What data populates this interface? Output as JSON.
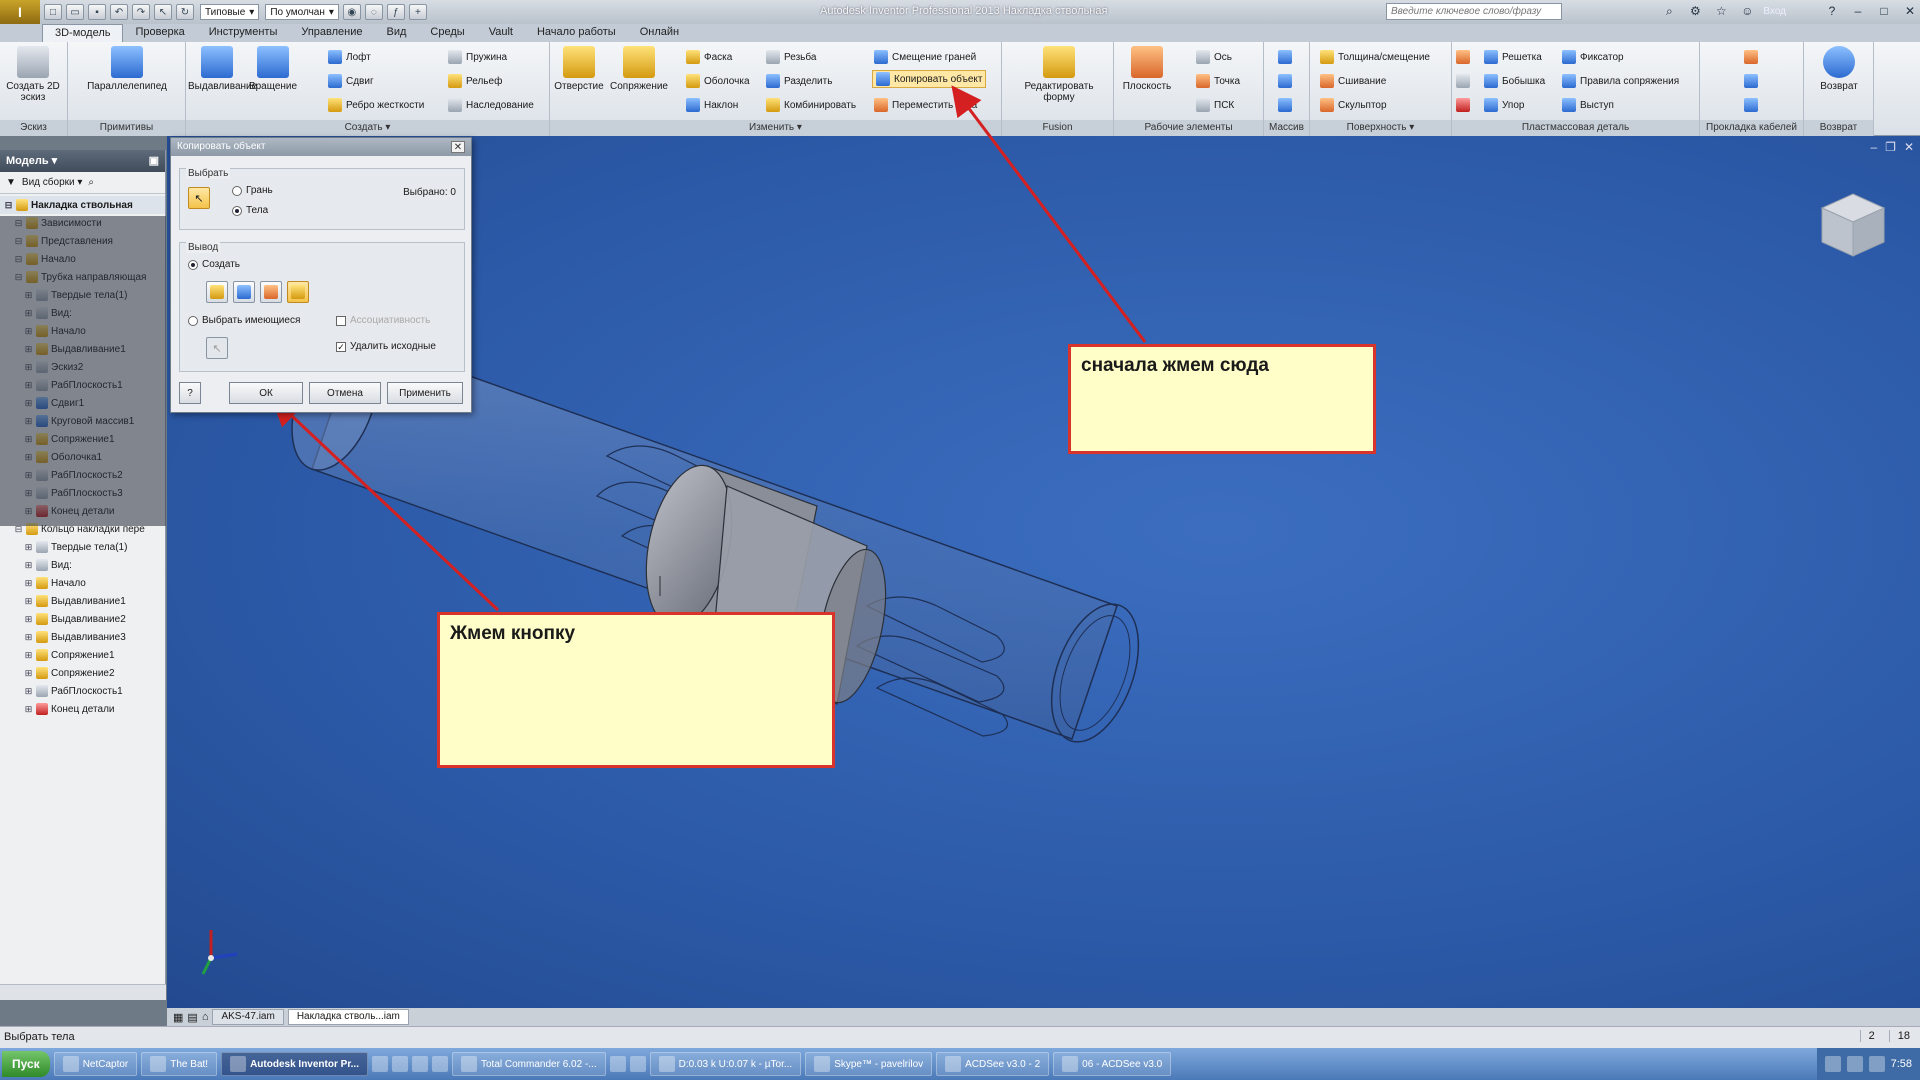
{
  "titlebar": {
    "app_title": "Autodesk Inventor Professional 2013   Накладка ствольная",
    "combo_style": "Типовые",
    "combo_material": "По умолчан",
    "search_placeholder": "Введите ключевое слово/фразу",
    "login": "Вход"
  },
  "ribbon_tabs": [
    "3D-модель",
    "Проверка",
    "Инструменты",
    "Управление",
    "Вид",
    "Среды",
    "Vault",
    "Начало работы",
    "Онлайн"
  ],
  "ribbon": {
    "panels": {
      "sketch": "Эскиз",
      "primitives": "Примитивы",
      "create": "Создать",
      "modify": "Изменить",
      "fusion": "Fusion",
      "work_features": "Рабочие элементы",
      "pattern": "Массив",
      "surface": "Поверхность",
      "plastic": "Пластмассовая деталь",
      "cable": "Прокладка кабелей",
      "return": "Возврат"
    },
    "tools": {
      "create_2d_sketch": "Создать 2D эскиз",
      "box": "Параллелепипед",
      "extrude": "Выдавливание",
      "revolve": "Вращение",
      "loft": "Лофт",
      "sweep": "Сдвиг",
      "rib": "Ребро жесткости",
      "coil": "Пружина",
      "emboss": "Рельеф",
      "derive": "Наследование",
      "hole": "Отверстие",
      "fillet": "Сопряжение",
      "chamfer": "Фаска",
      "shell": "Оболочка",
      "draft": "Наклон",
      "thread": "Резьба",
      "split": "Разделить",
      "combine": "Комбинировать",
      "face_offset": "Смещение граней",
      "copy_object": "Копировать объект",
      "move_bodies": "Переместить тела",
      "edit_form": "Редактировать форму",
      "plane": "Плоскость",
      "axis": "Ось",
      "point": "Точка",
      "ucs": "ПСК",
      "thicken": "Толщина/смещение",
      "stitch": "Сшивание",
      "sculpt": "Скульптор",
      "grill": "Решетка",
      "boss": "Бобышка",
      "rest": "Упор",
      "snap_fit": "Фиксатор",
      "rule_fillet": "Правила сопряжения",
      "lip": "Выступ",
      "return": "Возврат"
    }
  },
  "browser": {
    "title": "Модель",
    "view_mode": "Вид сборки",
    "tree": [
      {
        "label": "Накладка ствольная",
        "level": 0,
        "icon": "assembly-icon",
        "root": true
      },
      {
        "label": "Зависимости",
        "level": 1,
        "icon": "folder-icon"
      },
      {
        "label": "Представления",
        "level": 1,
        "icon": "folder-icon"
      },
      {
        "label": "Начало",
        "level": 1,
        "icon": "folder-icon"
      },
      {
        "label": "Трубка направляющая",
        "level": 1,
        "icon": "part-icon"
      },
      {
        "label": "Твердые тела(1)",
        "level": 2,
        "icon": "solid-icon"
      },
      {
        "label": "Вид:",
        "level": 2,
        "icon": "view-icon"
      },
      {
        "label": "Начало",
        "level": 2,
        "icon": "folder-icon"
      },
      {
        "label": "Выдавливание1",
        "level": 2,
        "icon": "extrude-icon"
      },
      {
        "label": "Эскиз2",
        "level": 2,
        "icon": "sketch-icon"
      },
      {
        "label": "РабПлоскость1",
        "level": 2,
        "icon": "plane-icon"
      },
      {
        "label": "Сдвиг1",
        "level": 2,
        "icon": "sweep-icon"
      },
      {
        "label": "Круговой массив1",
        "level": 2,
        "icon": "pattern-icon"
      },
      {
        "label": "Сопряжение1",
        "level": 2,
        "icon": "fillet-icon"
      },
      {
        "label": "Оболочка1",
        "level": 2,
        "icon": "shell-icon"
      },
      {
        "label": "РабПлоскость2",
        "level": 2,
        "icon": "plane-icon"
      },
      {
        "label": "РабПлоскость3",
        "level": 2,
        "icon": "plane-icon"
      },
      {
        "label": "Конец детали",
        "level": 2,
        "icon": "end-of-part-icon"
      },
      {
        "label": "Кольцо накладки пере",
        "level": 1,
        "icon": "part-icon"
      },
      {
        "label": "Твердые тела(1)",
        "level": 2,
        "icon": "solid-icon"
      },
      {
        "label": "Вид:",
        "level": 2,
        "icon": "view-icon"
      },
      {
        "label": "Начало",
        "level": 2,
        "icon": "folder-icon"
      },
      {
        "label": "Выдавливание1",
        "level": 2,
        "icon": "extrude-icon"
      },
      {
        "label": "Выдавливание2",
        "level": 2,
        "icon": "extrude-icon"
      },
      {
        "label": "Выдавливание3",
        "level": 2,
        "icon": "extrude-icon"
      },
      {
        "label": "Сопряжение1",
        "level": 2,
        "icon": "fillet-icon"
      },
      {
        "label": "Сопряжение2",
        "level": 2,
        "icon": "fillet-icon"
      },
      {
        "label": "РабПлоскость1",
        "level": 2,
        "icon": "plane-icon"
      },
      {
        "label": "Конец детали",
        "level": 2,
        "icon": "end-of-part-icon"
      }
    ]
  },
  "dialog": {
    "title": "Копировать объект",
    "select_group": "Выбрать",
    "option_face": "Грань",
    "option_body": "Тела",
    "selected_count": "Выбрано: 0",
    "output_group": "Вывод",
    "option_create": "Создать",
    "option_select_existing": "Выбрать имеющиеся",
    "associative": "Ассоциативность",
    "delete_originals": "Удалить исходные",
    "ok": "ОК",
    "cancel": "Отмена",
    "apply": "Применить",
    "help": "?"
  },
  "callouts": {
    "first": "сначала жмем сюда",
    "second": "Жмем кнопку"
  },
  "doc_tabs": [
    "AKS-47.iam",
    "Накладка стволь...iam"
  ],
  "status": {
    "text": "Выбрать тела",
    "count_a": "2",
    "count_b": "18"
  },
  "taskbar": {
    "start": "Пуск",
    "items": [
      "NetCaptor",
      "The Bat!",
      "Autodesk Inventor Pr...",
      "Total Commander 6.02 -...",
      "D:0.03 k U:0.07 k - µTor...",
      "Skype™ - pavelrilov",
      "ACDSee v3.0 - 2",
      "06 - ACDSee v3.0"
    ],
    "clock": "7:58"
  },
  "colors": {
    "callout_border": "#d9342b",
    "callout_fill": "#fffec8",
    "viewport_blue": "#2c5aa8",
    "arrow_red": "#d42020"
  }
}
